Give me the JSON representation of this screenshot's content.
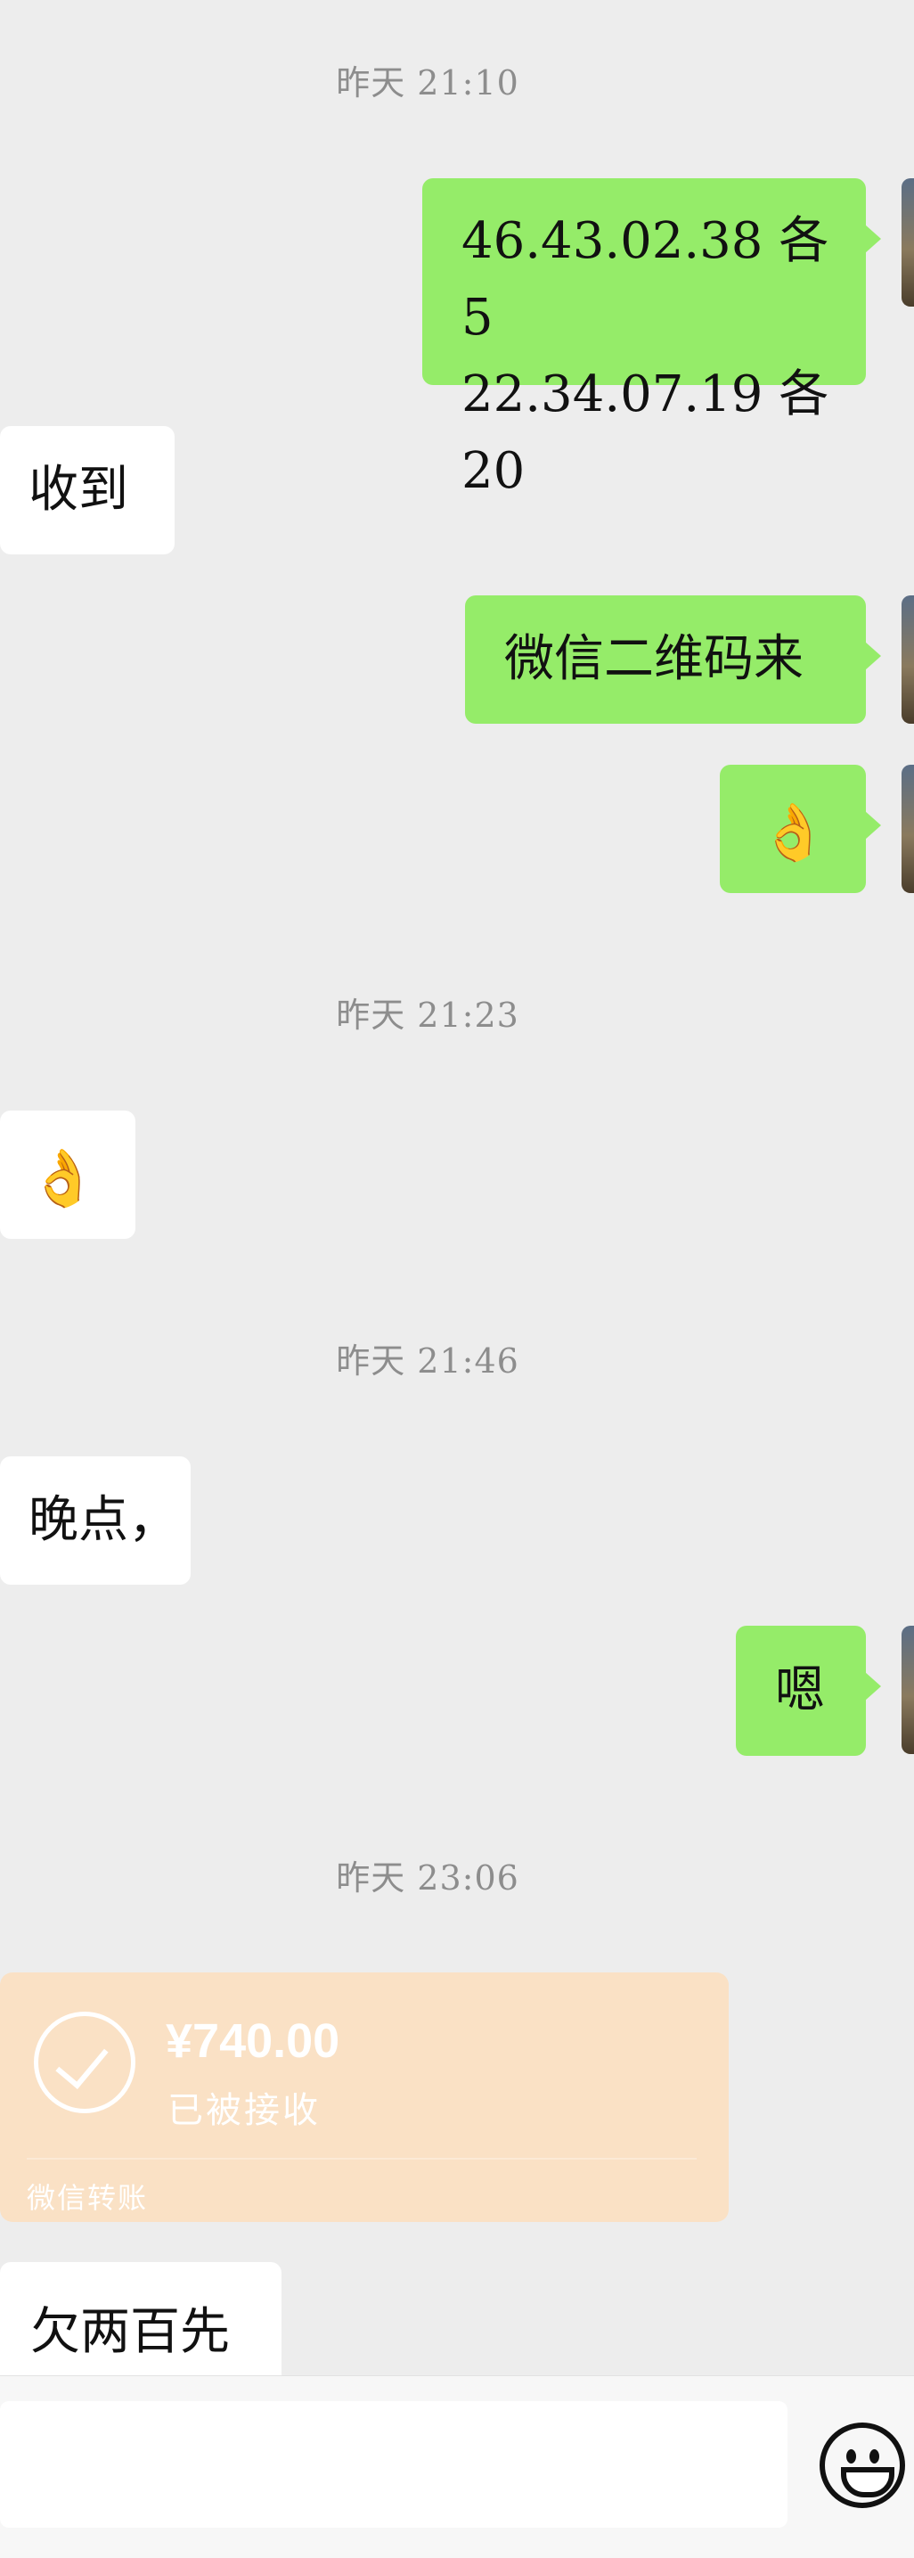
{
  "messages": {
    "ts1": "昨天 21:10",
    "m1_line1": "46.43.02.38 各 5",
    "m1_line2": "22.34.07.19 各 20",
    "m2": "收到",
    "m3": "微信二维码来",
    "m4_emoji": "👌",
    "ts2": "昨天 21:23",
    "m5_emoji": "👌",
    "ts3": "昨天 21:46",
    "m6": "晚点，",
    "m7": "嗯",
    "ts4": "昨天 23:06",
    "m9": "欠两百先"
  },
  "transfer": {
    "amount": "¥740.00",
    "status": "已被接收",
    "footer": "微信转账",
    "icon": "check-circle-icon"
  },
  "input_bar": {
    "value": "",
    "emoji_button_icon": "smiley-face-icon"
  },
  "colors": {
    "background": "#ededed",
    "outgoing_bubble": "#95ec69",
    "incoming_bubble": "#ffffff",
    "transfer_card": "#fae1c5",
    "timestamp_text": "#8d8d8d"
  }
}
